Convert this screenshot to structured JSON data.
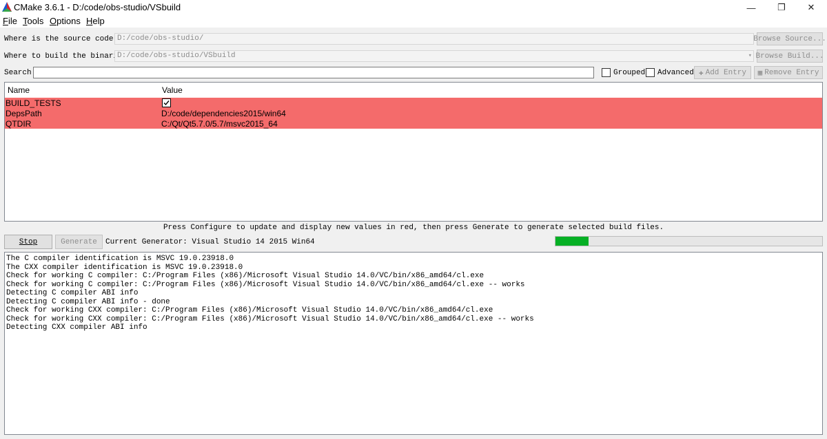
{
  "window": {
    "title": "CMake 3.6.1 - D:/code/obs-studio/VSbuild",
    "minimize_glyph": "—",
    "maximize_glyph": "❐",
    "close_glyph": "✕"
  },
  "menu": [
    {
      "accel": "F",
      "rest": "ile"
    },
    {
      "accel": "T",
      "rest": "ools"
    },
    {
      "accel": "O",
      "rest": "ptions"
    },
    {
      "accel": "H",
      "rest": "elp"
    }
  ],
  "source": {
    "label": "Where is the source code:",
    "value": "D:/code/obs-studio/",
    "browse_label": "Browse Source..."
  },
  "build": {
    "label": "Where to build the binaries:",
    "value": "D:/code/obs-studio/VSbuild",
    "browse_label": "Browse Build..."
  },
  "search": {
    "label": "Search:",
    "value": "",
    "grouped_label": "Grouped",
    "advanced_label": "Advanced",
    "add_entry_label": "Add Entry",
    "remove_entry_label": "Remove Entry"
  },
  "table": {
    "headers": {
      "name": "Name",
      "value": "Value"
    },
    "rows": [
      {
        "name": "BUILD_TESTS",
        "value": "",
        "is_checkbox": true,
        "checked": true
      },
      {
        "name": "DepsPath",
        "value": "D:/code/dependencies2015/win64"
      },
      {
        "name": "QTDIR",
        "value": "C:/Qt/Qt5.7.0/5.7/msvc2015_64"
      }
    ],
    "highlight_color": "#f46b6b"
  },
  "hint": "Press Configure to update and display new values in red, then press Generate to generate selected build files.",
  "actions": {
    "stop_label": "Stop",
    "generate_label": "Generate",
    "current_generator": "Current Generator: Visual Studio 14 2015 Win64"
  },
  "progress": {
    "fraction": 0.125,
    "color": "#06b025"
  },
  "output": [
    "The C compiler identification is MSVC 19.0.23918.0",
    "The CXX compiler identification is MSVC 19.0.23918.0",
    "Check for working C compiler: C:/Program Files (x86)/Microsoft Visual Studio 14.0/VC/bin/x86_amd64/cl.exe",
    "Check for working C compiler: C:/Program Files (x86)/Microsoft Visual Studio 14.0/VC/bin/x86_amd64/cl.exe -- works",
    "Detecting C compiler ABI info",
    "Detecting C compiler ABI info - done",
    "Check for working CXX compiler: C:/Program Files (x86)/Microsoft Visual Studio 14.0/VC/bin/x86_amd64/cl.exe",
    "Check for working CXX compiler: C:/Program Files (x86)/Microsoft Visual Studio 14.0/VC/bin/x86_amd64/cl.exe -- works",
    "Detecting CXX compiler ABI info"
  ]
}
